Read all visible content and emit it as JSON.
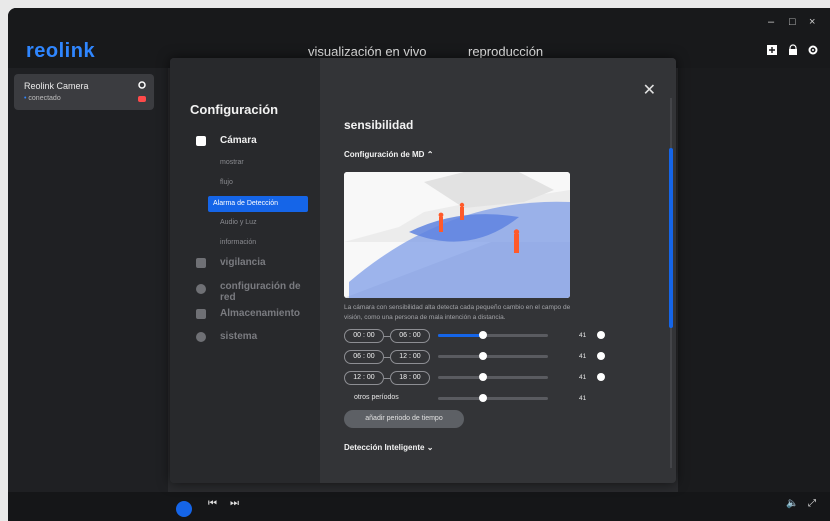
{
  "brand": {
    "logo_text": "reolink",
    "accent": "#2f86ff"
  },
  "nav": {
    "live": "visualización en vivo",
    "playback": "reproducción"
  },
  "window_controls": {
    "minimize": "–",
    "maximize": "□",
    "close": "×"
  },
  "top_icons": [
    "add-icon",
    "lock-icon",
    "gear-icon"
  ],
  "camera": {
    "name": "Reolink Camera",
    "status": "conectado"
  },
  "modal": {
    "title": "Configuración",
    "menu": [
      {
        "label": "Cámara",
        "icon": "camera-icon"
      },
      {
        "label": "vigilancia",
        "icon": "shield-icon"
      },
      {
        "label": "configuración de red",
        "icon": "network-icon"
      },
      {
        "label": "Almacenamiento",
        "icon": "storage-icon"
      },
      {
        "label": "sistema",
        "icon": "gear-icon"
      }
    ],
    "submenu": [
      "mostrar",
      "flujo",
      "Alarma de Detección",
      "Audio y Luz",
      "información"
    ],
    "active_submenu": "Alarma de Detección"
  },
  "settings": {
    "section": "sensibilidad",
    "md_title": "Configuración de MD",
    "description": "La cámara con sensibilidad alta detecta cada pequeño cambio en el campo de visión, como una persona de mala intención a distancia.",
    "periods": [
      {
        "start": "00 : 00",
        "end": "06 : 00",
        "value": "41",
        "sensitivity": 0.41
      },
      {
        "start": "06 : 00",
        "end": "12 : 00",
        "value": "41",
        "sensitivity": 0.41
      },
      {
        "start": "12 : 00",
        "end": "18 : 00",
        "value": "41",
        "sensitivity": 0.41
      }
    ],
    "other_periods_label": "otros períodos",
    "other_periods_value": "41",
    "other_periods_sensitivity": 0.41,
    "add_button": "añadir periodo de tiempo",
    "smart_detection": "Detección Inteligente"
  }
}
